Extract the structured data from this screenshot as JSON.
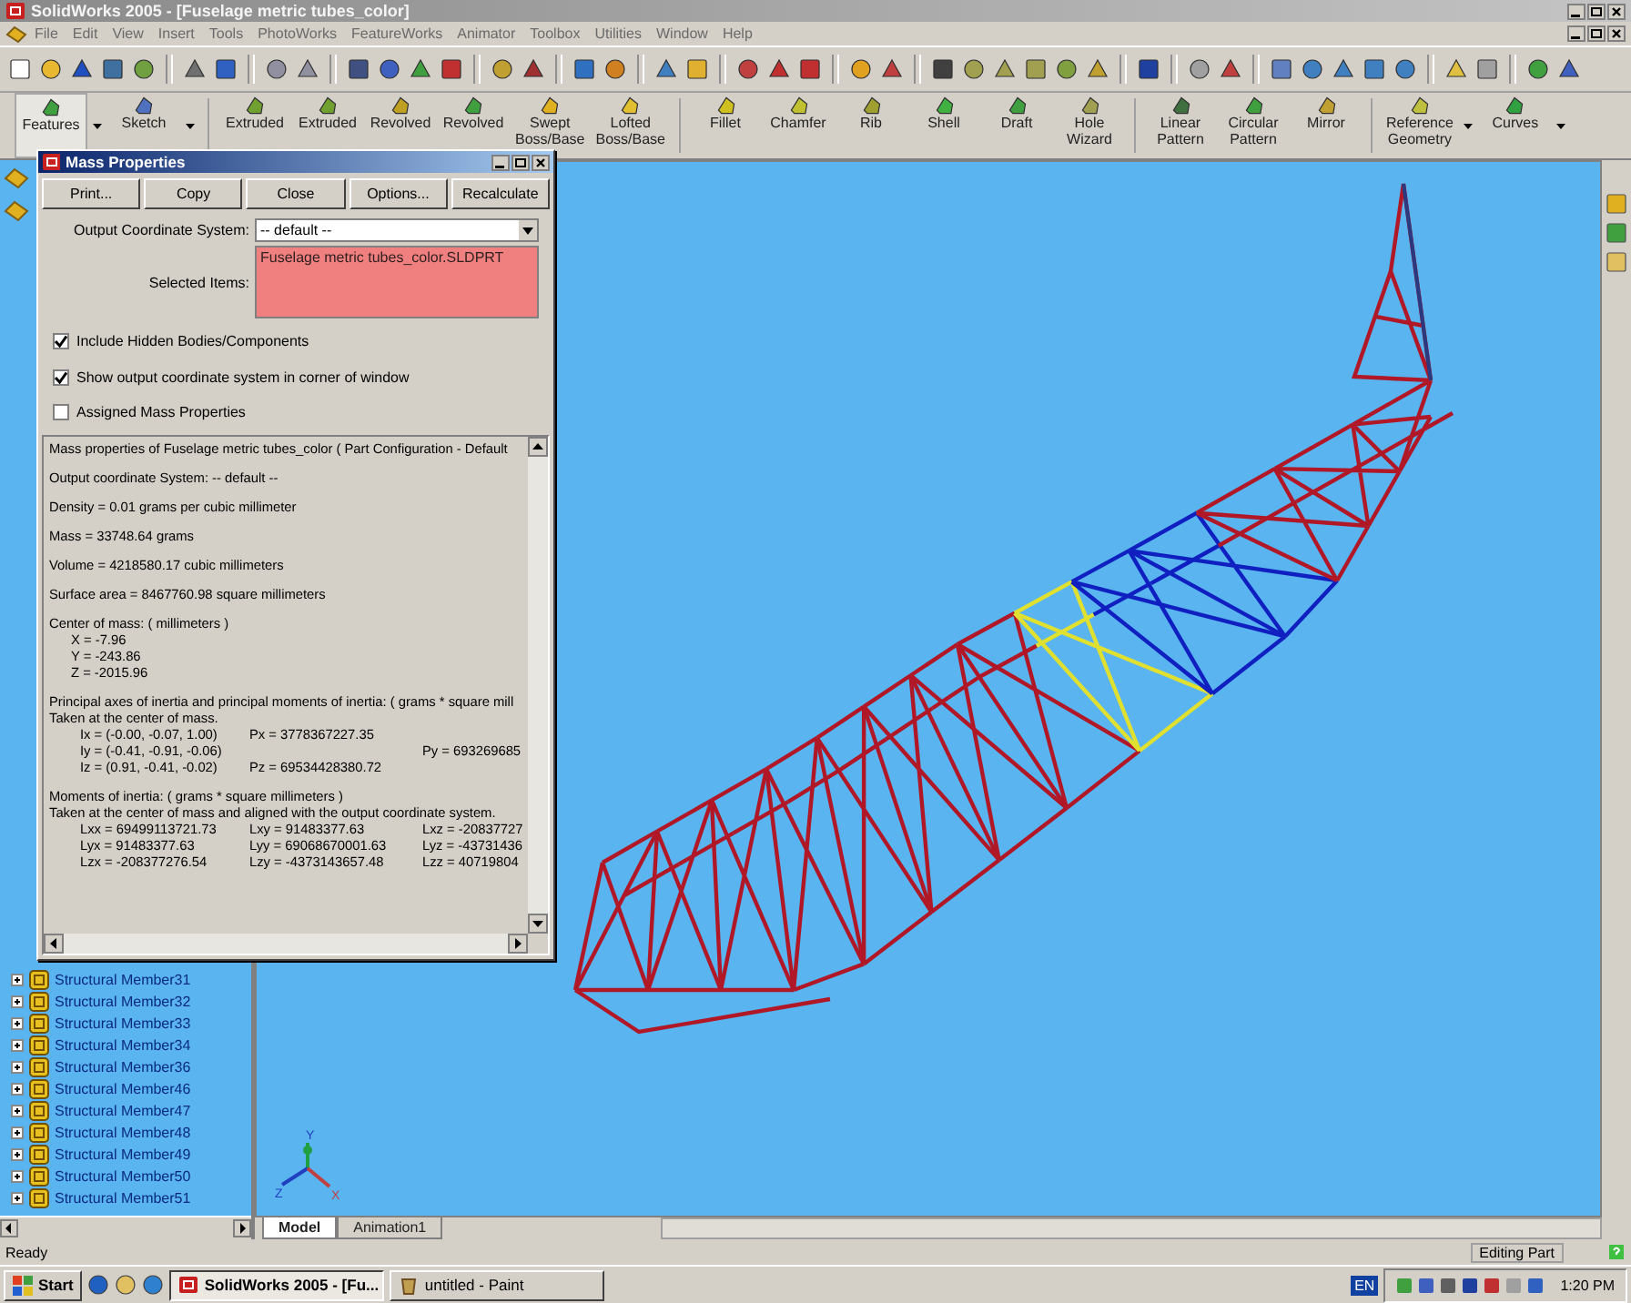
{
  "window": {
    "title": "SolidWorks 2005 - [Fuselage metric tubes_color]"
  },
  "menu_bar": {
    "items": [
      "File",
      "Edit",
      "View",
      "Insert",
      "Tools",
      "PhotoWorks",
      "FeatureWorks",
      "Animator",
      "Toolbox",
      "Utilities",
      "Window",
      "Help"
    ]
  },
  "command_manager": {
    "buttons": [
      {
        "lines": [
          "Features"
        ],
        "dropdown": true,
        "selected": true
      },
      {
        "lines": [
          "Sketch"
        ],
        "dropdown": true,
        "selected": false
      },
      {
        "lines": [
          "Extruded"
        ],
        "dropdown": false,
        "selected": false
      },
      {
        "lines": [
          "Extruded"
        ],
        "dropdown": false,
        "selected": false
      },
      {
        "lines": [
          "Revolved"
        ],
        "dropdown": false,
        "selected": false
      },
      {
        "lines": [
          "Revolved"
        ],
        "dropdown": false,
        "selected": false
      },
      {
        "lines": [
          "Swept",
          "Boss/Base"
        ],
        "dropdown": false,
        "selected": false
      },
      {
        "lines": [
          "Lofted",
          "Boss/Base"
        ],
        "dropdown": false,
        "selected": false
      },
      {
        "lines": [
          "Fillet"
        ],
        "dropdown": false,
        "selected": false
      },
      {
        "lines": [
          "Chamfer"
        ],
        "dropdown": false,
        "selected": false
      },
      {
        "lines": [
          "Rib"
        ],
        "dropdown": false,
        "selected": false
      },
      {
        "lines": [
          "Shell"
        ],
        "dropdown": false,
        "selected": false
      },
      {
        "lines": [
          "Draft"
        ],
        "dropdown": false,
        "selected": false
      },
      {
        "lines": [
          "Hole",
          "Wizard"
        ],
        "dropdown": false,
        "selected": false
      },
      {
        "lines": [
          "Linear",
          "Pattern"
        ],
        "dropdown": false,
        "selected": false
      },
      {
        "lines": [
          "Circular",
          "Pattern"
        ],
        "dropdown": false,
        "selected": false
      },
      {
        "lines": [
          "Mirror"
        ],
        "dropdown": false,
        "selected": false
      },
      {
        "lines": [
          "Reference",
          "Geometry"
        ],
        "dropdown": true,
        "selected": false
      },
      {
        "lines": [
          "Curves"
        ],
        "dropdown": true,
        "selected": false
      }
    ]
  },
  "feature_tree": {
    "items": [
      {
        "label": "Structural Member31",
        "expanded": false
      },
      {
        "label": "Structural Member32",
        "expanded": false
      },
      {
        "label": "Structural Member33",
        "expanded": false
      },
      {
        "label": "Structural Member34",
        "expanded": false
      },
      {
        "label": "Structural Member36",
        "expanded": false
      },
      {
        "label": "Structural Member46",
        "expanded": false
      },
      {
        "label": "Structural Member47",
        "expanded": false
      },
      {
        "label": "Structural Member48",
        "expanded": false
      },
      {
        "label": "Structural Member49",
        "expanded": false
      },
      {
        "label": "Structural Member50",
        "expanded": false
      },
      {
        "label": "Structural Member51",
        "expanded": false
      }
    ]
  },
  "viewport": {
    "triad_labels": [
      "Y",
      "Z",
      "X"
    ],
    "tabs": [
      {
        "label": "Model",
        "selected": true
      },
      {
        "label": "Animation1",
        "selected": false
      }
    ]
  },
  "mass_properties_dialog": {
    "title": "Mass Properties",
    "buttons": [
      "Print...",
      "Copy",
      "Close",
      "Options...",
      "Recalculate"
    ],
    "coordinate_system": {
      "label": "Output Coordinate System:",
      "value": "-- default --"
    },
    "selected_items": {
      "label": "Selected Items:",
      "items": [
        "Fuselage metric tubes_color.SLDPRT"
      ]
    },
    "options": [
      {
        "label": "Include Hidden Bodies/Components",
        "checked": true
      },
      {
        "label": "Show output coordinate system in corner of window",
        "checked": true
      },
      {
        "label": "Assigned Mass Properties",
        "checked": false
      }
    ],
    "report": [
      [
        {
          "kind": "line",
          "cells": [
            "Mass properties of Fuselage metric tubes_color ( Part Configuration - Default"
          ]
        }
      ],
      [
        {
          "kind": "line",
          "cells": [
            "Output  coordinate System: -- default --"
          ]
        }
      ],
      [
        {
          "kind": "line",
          "cells": [
            "Density = 0.01 grams per cubic millimeter"
          ]
        }
      ],
      [
        {
          "kind": "line",
          "cells": [
            "Mass = 33748.64 grams"
          ]
        }
      ],
      [
        {
          "kind": "line",
          "cells": [
            "Volume = 4218580.17 cubic millimeters"
          ]
        }
      ],
      [
        {
          "kind": "line",
          "cells": [
            "Surface area = 8467760.98 square millimeters"
          ]
        }
      ],
      [
        {
          "kind": "line",
          "cells": [
            "Center of mass: ( millimeters )"
          ]
        },
        {
          "kind": "indented",
          "cells": [
            "X = -7.96"
          ]
        },
        {
          "kind": "indented",
          "cells": [
            "Y = -243.86"
          ]
        },
        {
          "kind": "indented",
          "cells": [
            "Z = -2015.96"
          ]
        }
      ],
      [
        {
          "kind": "line",
          "cells": [
            "Principal axes of inertia and principal moments of inertia: ( grams * square mill"
          ]
        },
        {
          "kind": "line",
          "cells": [
            "Taken at the center of mass."
          ]
        },
        {
          "kind": "pair",
          "cells": [
            "Ix = (-0.00, -0.07, 1.00)",
            "Px = 3778367227.35"
          ]
        },
        {
          "kind": "pair_far",
          "cells": [
            "Iy = (-0.41, -0.91, -0.06)",
            "Py = 693269685"
          ]
        },
        {
          "kind": "pair",
          "cells": [
            "Iz = (0.91, -0.41, -0.02)",
            "Pz = 69534428380.72"
          ]
        }
      ],
      [
        {
          "kind": "line",
          "cells": [
            "Moments of inertia: ( grams * square millimeters )"
          ]
        },
        {
          "kind": "line",
          "cells": [
            "Taken at the center of mass and aligned with the output coordinate system."
          ]
        },
        {
          "kind": "triple",
          "cells": [
            "Lxx = 69499113721.73",
            "Lxy = 91483377.63",
            "Lxz = -20837727"
          ]
        },
        {
          "kind": "triple",
          "cells": [
            "Lyx = 91483377.63",
            "Lyy = 69068670001.63",
            "Lyz = -43731436"
          ]
        },
        {
          "kind": "triple",
          "cells": [
            "Lzx = -208377276.54",
            "Lzy = -4373143657.48",
            "Lzz = 40719804"
          ]
        }
      ]
    ]
  },
  "status_bar": {
    "text": "Ready",
    "mode": "Editing Part"
  },
  "taskbar": {
    "start": "Start",
    "tasks": [
      {
        "label": "SolidWorks 2005 - [Fu...",
        "selected": true
      },
      {
        "label": "untitled - Paint",
        "selected": false
      }
    ],
    "language": "EN",
    "clock": "1:20 PM"
  }
}
